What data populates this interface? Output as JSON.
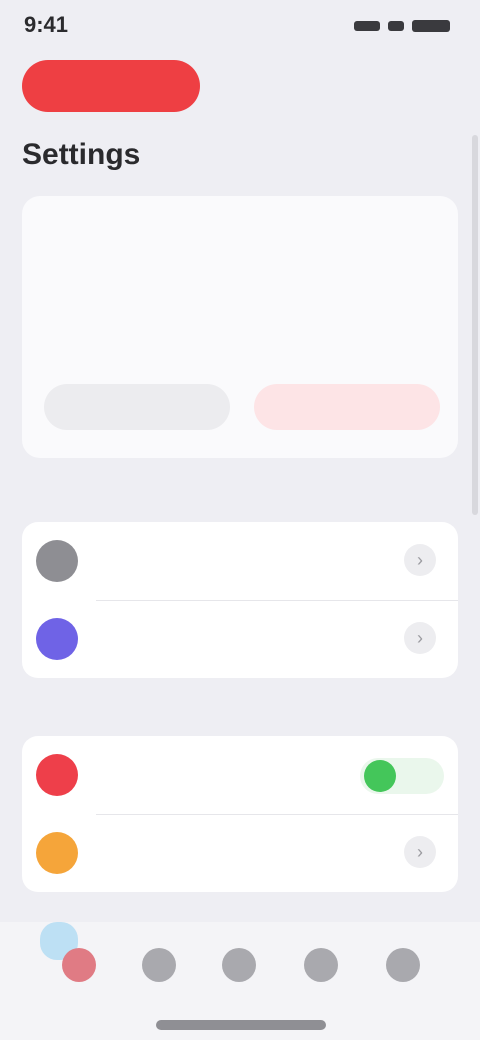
{
  "status_bar": {
    "time": "9:41"
  },
  "banner": {
    "label": ""
  },
  "page": {
    "title": "Settings"
  },
  "card": {
    "title": "",
    "body": "",
    "secondary_button": "",
    "primary_button": ""
  },
  "sections": [
    {
      "header": "",
      "rows": [
        {
          "title": "",
          "subtitle": "",
          "icon_color": "#8e8e93",
          "icon": "gray-circle-icon",
          "control": "chevron"
        },
        {
          "title": "",
          "subtitle": "",
          "icon_color": "#6f63e6",
          "icon": "purple-circle-icon",
          "control": "chevron"
        }
      ]
    },
    {
      "header": "",
      "rows": [
        {
          "title": "",
          "subtitle": "",
          "icon_color": "#ee3f4a",
          "icon": "red-circle-icon",
          "control": "toggle",
          "toggle_on": true
        },
        {
          "title": "",
          "subtitle": "",
          "icon_color": "#f5a53a",
          "icon": "orange-circle-icon",
          "control": "chevron"
        }
      ]
    }
  ],
  "colors": {
    "accent_red": "#ee3f43",
    "toggle_green": "#44c65a",
    "background": "#eeeef3"
  },
  "tab_bar": {
    "tabs": [
      "tab-1",
      "tab-2",
      "tab-3",
      "tab-4",
      "tab-5"
    ],
    "active_index": 0
  }
}
